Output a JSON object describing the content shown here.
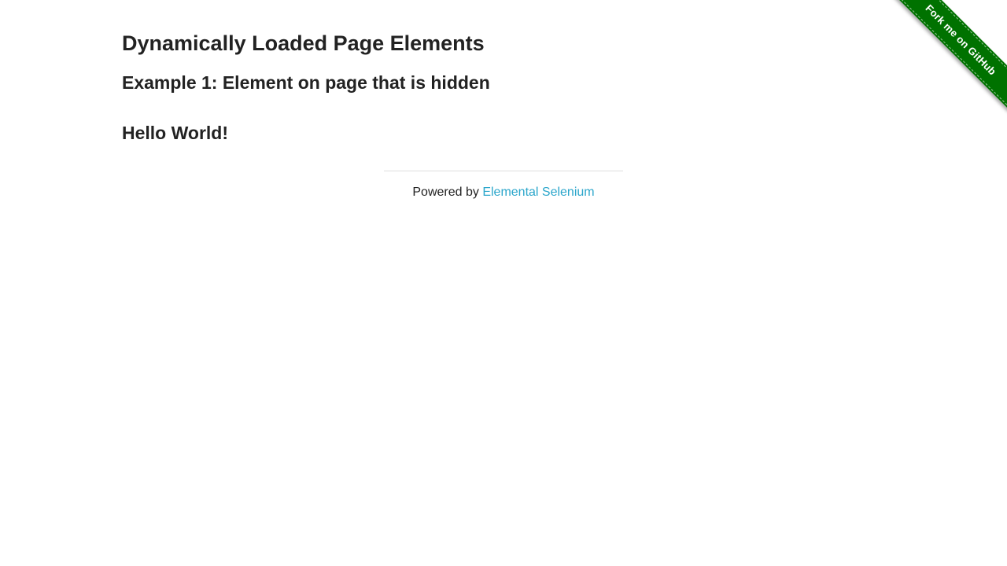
{
  "page": {
    "title": "Dynamically Loaded Page Elements",
    "example_title": "Example 1: Element on page that is hidden",
    "finish_text": "Hello World!"
  },
  "footer": {
    "prefix": "Powered by ",
    "link_label": "Elemental Selenium"
  },
  "ribbon": {
    "label": "Fork me on GitHub",
    "color": "#007200"
  },
  "colors": {
    "text": "#222222",
    "link": "#2ba6cb",
    "divider": "#dddddd"
  }
}
